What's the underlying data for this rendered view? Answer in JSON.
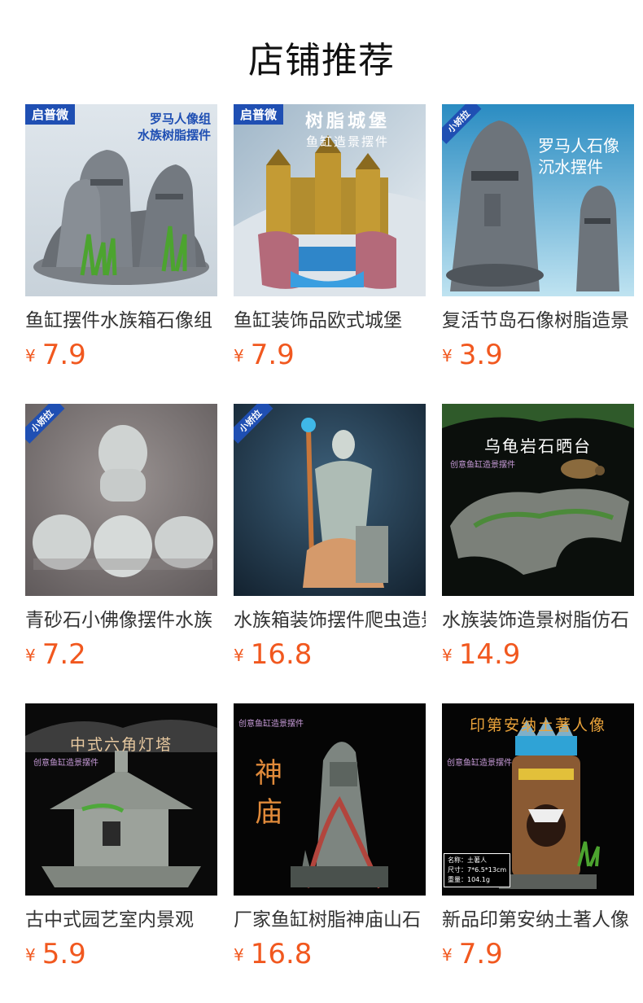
{
  "title": "店铺推荐",
  "currency": "¥",
  "products": [
    {
      "name": "鱼缸摆件水族箱石像组",
      "price": "7.9",
      "tag": "启普微",
      "tag_style": "box",
      "caption": [
        "罗马人像组",
        "水族树脂摆件"
      ],
      "scene": "moai-group"
    },
    {
      "name": "鱼缸装饰品欧式城堡",
      "price": "7.9",
      "tag": "启普微",
      "tag_style": "box",
      "caption": [
        "树脂城堡",
        "鱼缸造景摆件"
      ],
      "scene": "castle"
    },
    {
      "name": "复活节岛石像树脂造景",
      "price": "3.9",
      "tag": "小娇拉",
      "tag_style": "corner",
      "caption": [
        "罗马人石像",
        "沉水摆件"
      ],
      "scene": "moai-pair"
    },
    {
      "name": "青砂石小佛像摆件水族",
      "price": "7.2",
      "tag": "小娇拉",
      "tag_style": "corner",
      "caption": [],
      "scene": "buddhas"
    },
    {
      "name": "水族箱装饰摆件爬虫造景",
      "price": "16.8",
      "tag": "小娇拉",
      "tag_style": "corner",
      "caption": [],
      "scene": "wizard"
    },
    {
      "name": "水族装饰造景树脂仿石",
      "price": "14.9",
      "tag": "",
      "tag_style": "",
      "caption": [
        "乌龟岩石晒台",
        "创意鱼缸造景摆件"
      ],
      "scene": "turtle-rock"
    },
    {
      "name": "古中式园艺室内景观",
      "price": "5.9",
      "tag": "",
      "tag_style": "",
      "caption": [
        "中式六角灯塔",
        "创意鱼缸造景摆件"
      ],
      "scene": "lantern"
    },
    {
      "name": "厂家鱼缸树脂神庙山石",
      "price": "16.8",
      "tag": "",
      "tag_style": "",
      "caption": [
        "神",
        "庙",
        "创意鱼缸造景摆件"
      ],
      "scene": "temple"
    },
    {
      "name": "新品印第安纳土著人像",
      "price": "7.9",
      "tag": "",
      "tag_style": "",
      "caption": [
        "印第安纳土著人像",
        "创意鱼缸造景摆件"
      ],
      "spec": [
        "名称：土著人",
        "尺寸：7*6.5*13cm",
        "重量：104.1g"
      ],
      "scene": "tiki"
    }
  ]
}
